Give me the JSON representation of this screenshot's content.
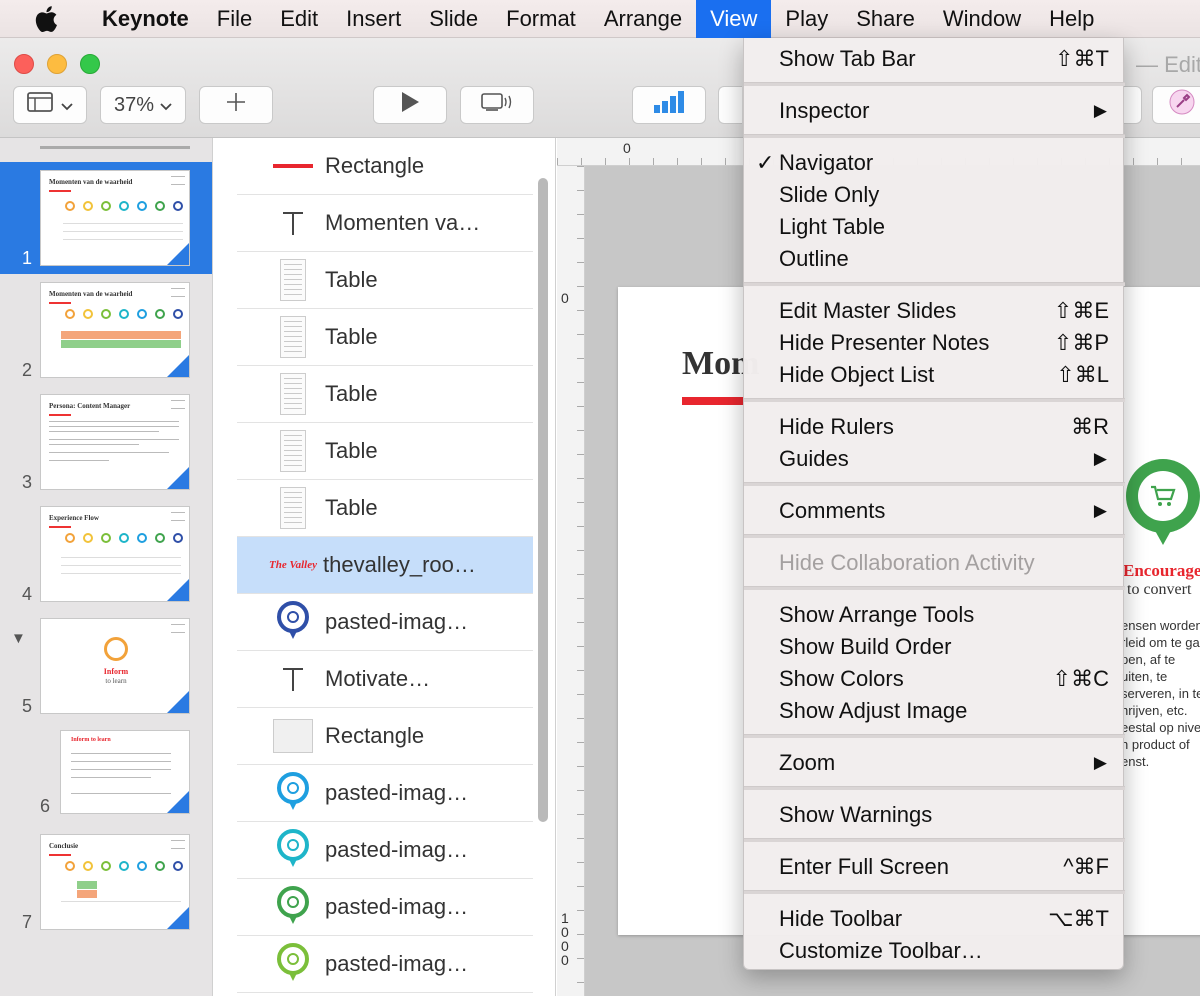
{
  "menubar": {
    "app": "Keynote",
    "items": [
      "File",
      "Edit",
      "Insert",
      "Slide",
      "Format",
      "Arrange",
      "View",
      "Play",
      "Share",
      "Window",
      "Help"
    ],
    "active": "View"
  },
  "window": {
    "zoom": "37%",
    "edited_label": "Edited"
  },
  "navigator": {
    "slides": [
      {
        "number": "1",
        "title": "Momenten van de waarheid",
        "selected": true
      },
      {
        "number": "2",
        "title": "Momenten van de waarheid"
      },
      {
        "number": "3",
        "title": "Persona: Content Manager"
      },
      {
        "number": "4",
        "title": "Experience Flow"
      },
      {
        "number": "5",
        "title": "Inform",
        "subtitle": "to learn",
        "collapse_arrow": "▼"
      },
      {
        "number": "6",
        "title": "Inform to learn"
      },
      {
        "number": "7",
        "title": "Conclusie"
      }
    ]
  },
  "object_list": {
    "items": [
      {
        "label": "Rectangle",
        "icon": "red-line-icon"
      },
      {
        "label": "Momenten va…",
        "icon": "text-icon"
      },
      {
        "label": "Table",
        "icon": "table-icon"
      },
      {
        "label": "Table",
        "icon": "table-icon"
      },
      {
        "label": "Table",
        "icon": "table-icon"
      },
      {
        "label": "Table",
        "icon": "table-icon"
      },
      {
        "label": "Table",
        "icon": "table-icon"
      },
      {
        "label": "thevalley_roo…",
        "icon": "the-valley-logo-icon",
        "selected": true,
        "logo_text": "The Valley"
      },
      {
        "label": "pasted-imag…",
        "icon": "megaphone-pin-icon",
        "color": "#2f4fa8"
      },
      {
        "label": "Motivate…",
        "icon": "text-icon"
      },
      {
        "label": "Rectangle",
        "icon": "rectangle-icon"
      },
      {
        "label": "pasted-imag…",
        "icon": "chat-pin-icon",
        "color": "#1e9fe0"
      },
      {
        "label": "pasted-imag…",
        "icon": "check-pin-icon",
        "color": "#1eb5c9"
      },
      {
        "label": "pasted-imag…",
        "icon": "cart-pin-icon",
        "color": "#3fa34d"
      },
      {
        "label": "pasted-imag…",
        "icon": "people-pin-icon",
        "color": "#7bbf3a"
      }
    ]
  },
  "canvas": {
    "ruler_h_label": "0",
    "ruler_v_top": "0",
    "ruler_v_bottom": "1000",
    "slide": {
      "title": "Mom",
      "encourage": "Encourage",
      "encourage_sub": "to convert",
      "body_lines": [
        "ensen worden",
        "rleid om te ga",
        "pen, af te",
        "uiten, te",
        "serveren, in te",
        "hrijven, etc.",
        "eestal op nive",
        "n product of",
        "enst."
      ]
    }
  },
  "view_menu": {
    "groups": [
      [
        {
          "label": "Show Tab Bar",
          "shortcut": "⇧⌘T"
        }
      ],
      [
        {
          "label": "Inspector",
          "submenu": true
        }
      ],
      [
        {
          "label": "Navigator",
          "checked": true
        },
        {
          "label": "Slide Only"
        },
        {
          "label": "Light Table"
        },
        {
          "label": "Outline"
        }
      ],
      [
        {
          "label": "Edit Master Slides",
          "shortcut": "⇧⌘E"
        },
        {
          "label": "Hide Presenter Notes",
          "shortcut": "⇧⌘P"
        },
        {
          "label": "Hide Object List",
          "shortcut": "⇧⌘L"
        }
      ],
      [
        {
          "label": "Hide Rulers",
          "shortcut": "⌘R"
        },
        {
          "label": "Guides",
          "submenu": true
        }
      ],
      [
        {
          "label": "Comments",
          "submenu": true
        }
      ],
      [
        {
          "label": "Hide Collaboration Activity",
          "disabled": true
        }
      ],
      [
        {
          "label": "Show Arrange Tools"
        },
        {
          "label": "Show Build Order"
        },
        {
          "label": "Show Colors",
          "shortcut": "⇧⌘C"
        },
        {
          "label": "Show Adjust Image"
        }
      ],
      [
        {
          "label": "Zoom",
          "submenu": true
        }
      ],
      [
        {
          "label": "Show Warnings"
        }
      ],
      [
        {
          "label": "Enter Full Screen",
          "shortcut": "^⌘F"
        }
      ],
      [
        {
          "label": "Hide Toolbar",
          "shortcut": "⌥⌘T"
        },
        {
          "label": "Customize Toolbar…"
        }
      ]
    ],
    "check_glyph": "✓",
    "submenu_glyph": "▶"
  },
  "colors": {
    "accent_blue": "#2a7ae2",
    "menu_highlight": "#1a6ff0",
    "brand_red": "#e8262e",
    "cart_green": "#3fa34d"
  }
}
